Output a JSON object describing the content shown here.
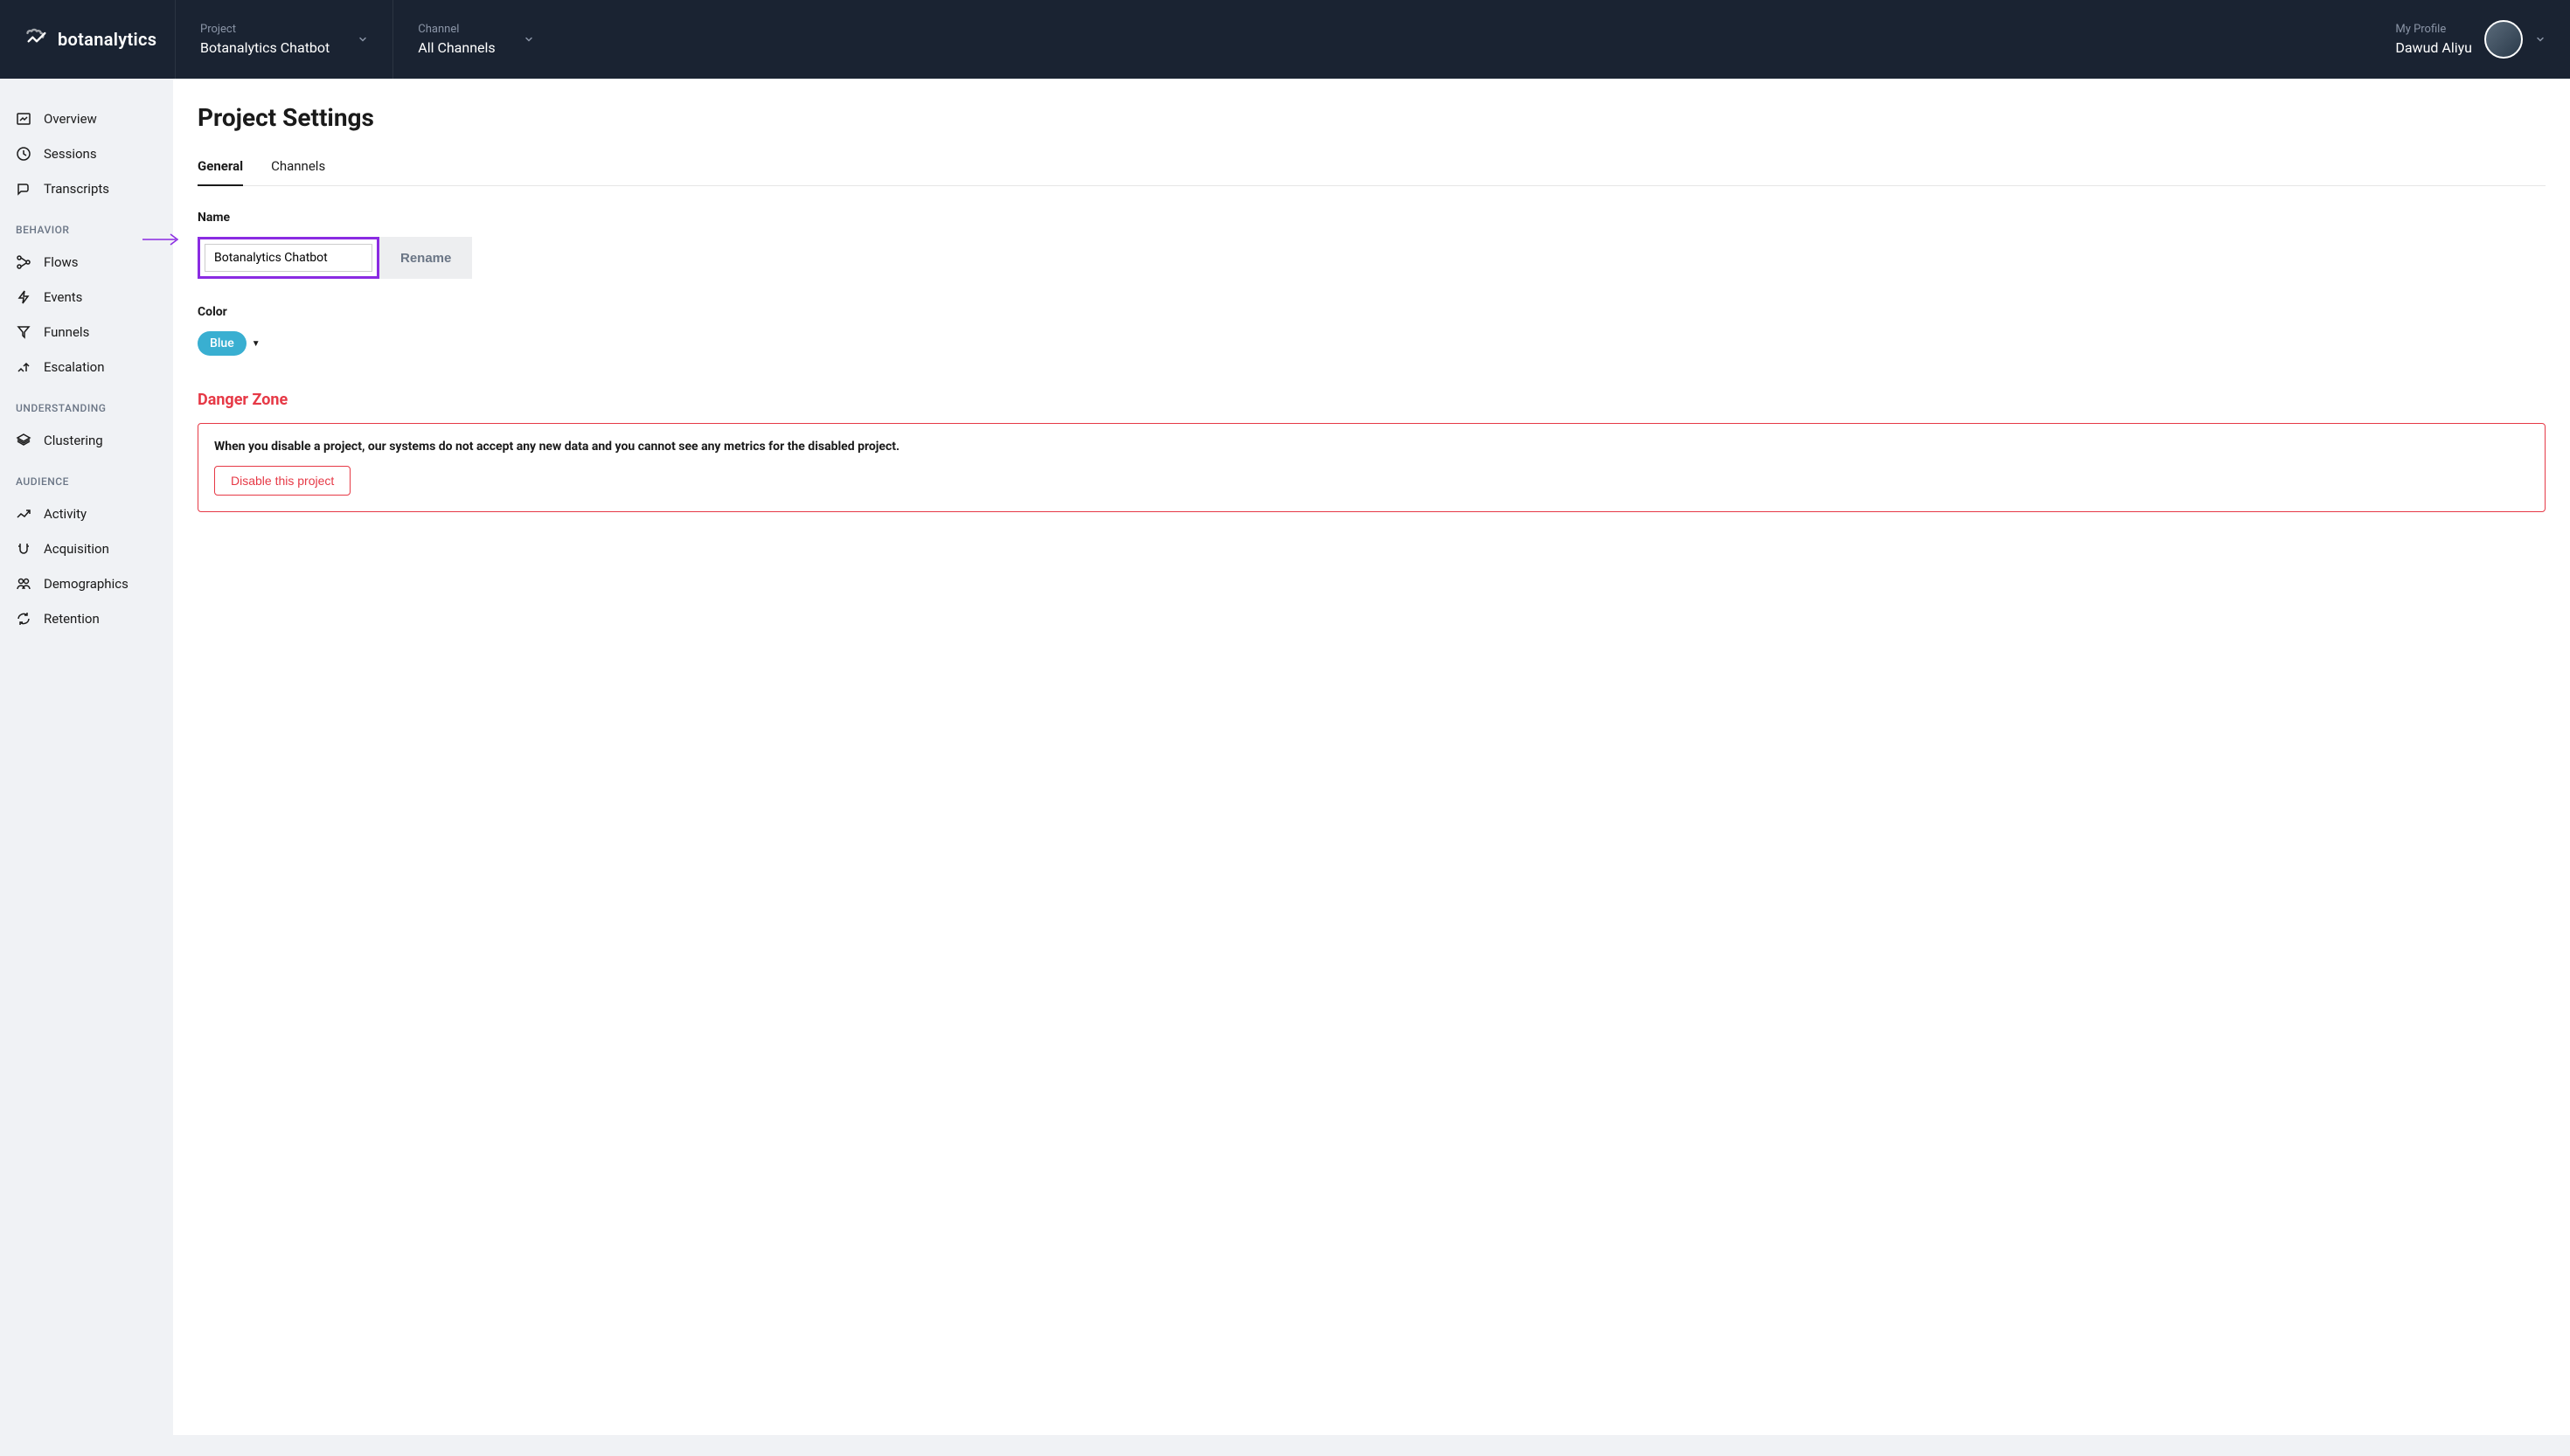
{
  "brand": "botanalytics",
  "topbar": {
    "project": {
      "label": "Project",
      "value": "Botanalytics Chatbot"
    },
    "channel": {
      "label": "Channel",
      "value": "All Channels"
    },
    "profile": {
      "label": "My Profile",
      "value": "Dawud Aliyu"
    }
  },
  "sidebar": {
    "items_top": [
      {
        "label": "Overview"
      },
      {
        "label": "Sessions"
      },
      {
        "label": "Transcripts"
      }
    ],
    "headings": {
      "behavior": "BEHAVIOR",
      "understanding": "UNDERSTANDING",
      "audience": "AUDIENCE"
    },
    "items_behavior": [
      {
        "label": "Flows"
      },
      {
        "label": "Events"
      },
      {
        "label": "Funnels"
      },
      {
        "label": "Escalation"
      }
    ],
    "items_understanding": [
      {
        "label": "Clustering"
      }
    ],
    "items_audience": [
      {
        "label": "Activity"
      },
      {
        "label": "Acquisition"
      },
      {
        "label": "Demographics"
      },
      {
        "label": "Retention"
      }
    ]
  },
  "page": {
    "title": "Project Settings",
    "tabs": {
      "general": "General",
      "channels": "Channels"
    },
    "name_label": "Name",
    "name_value": "Botanalytics Chatbot",
    "rename_label": "Rename",
    "color_label": "Color",
    "color_value": "Blue",
    "danger_title": "Danger Zone",
    "danger_text": "When you disable a project, our systems do not accept any new data and you cannot see any metrics for the disabled project.",
    "disable_label": "Disable this project"
  }
}
